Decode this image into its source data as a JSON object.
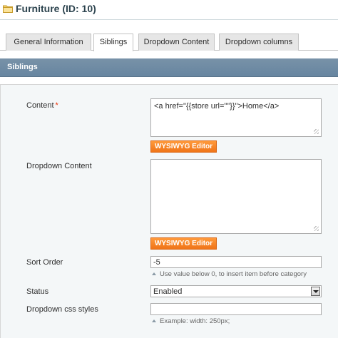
{
  "header": {
    "title": "Furniture (ID: 10)"
  },
  "tabs": [
    {
      "label": "General Information",
      "active": false
    },
    {
      "label": "Siblings",
      "active": true
    },
    {
      "label": "Dropdown Content",
      "active": false
    },
    {
      "label": "Dropdown columns",
      "active": false
    }
  ],
  "section": {
    "title": "Siblings"
  },
  "form": {
    "content": {
      "label": "Content",
      "required_mark": "*",
      "value": "<a href=\"{{store url=\"\"}}\">Home</a>",
      "button": "WYSIWYG Editor"
    },
    "dropdown_content": {
      "label": "Dropdown Content",
      "value": "",
      "button": "WYSIWYG Editor"
    },
    "sort_order": {
      "label": "Sort Order",
      "value": "-5",
      "note": "Use value below 0, to insert item before category"
    },
    "status": {
      "label": "Status",
      "selected": "Enabled"
    },
    "css_styles": {
      "label": "Dropdown css styles",
      "value": "",
      "note": "Example: width: 250px;"
    }
  },
  "colors": {
    "section_bar": "#6f8ba4",
    "button_orange": "#f58220",
    "required": "#eb340a"
  }
}
